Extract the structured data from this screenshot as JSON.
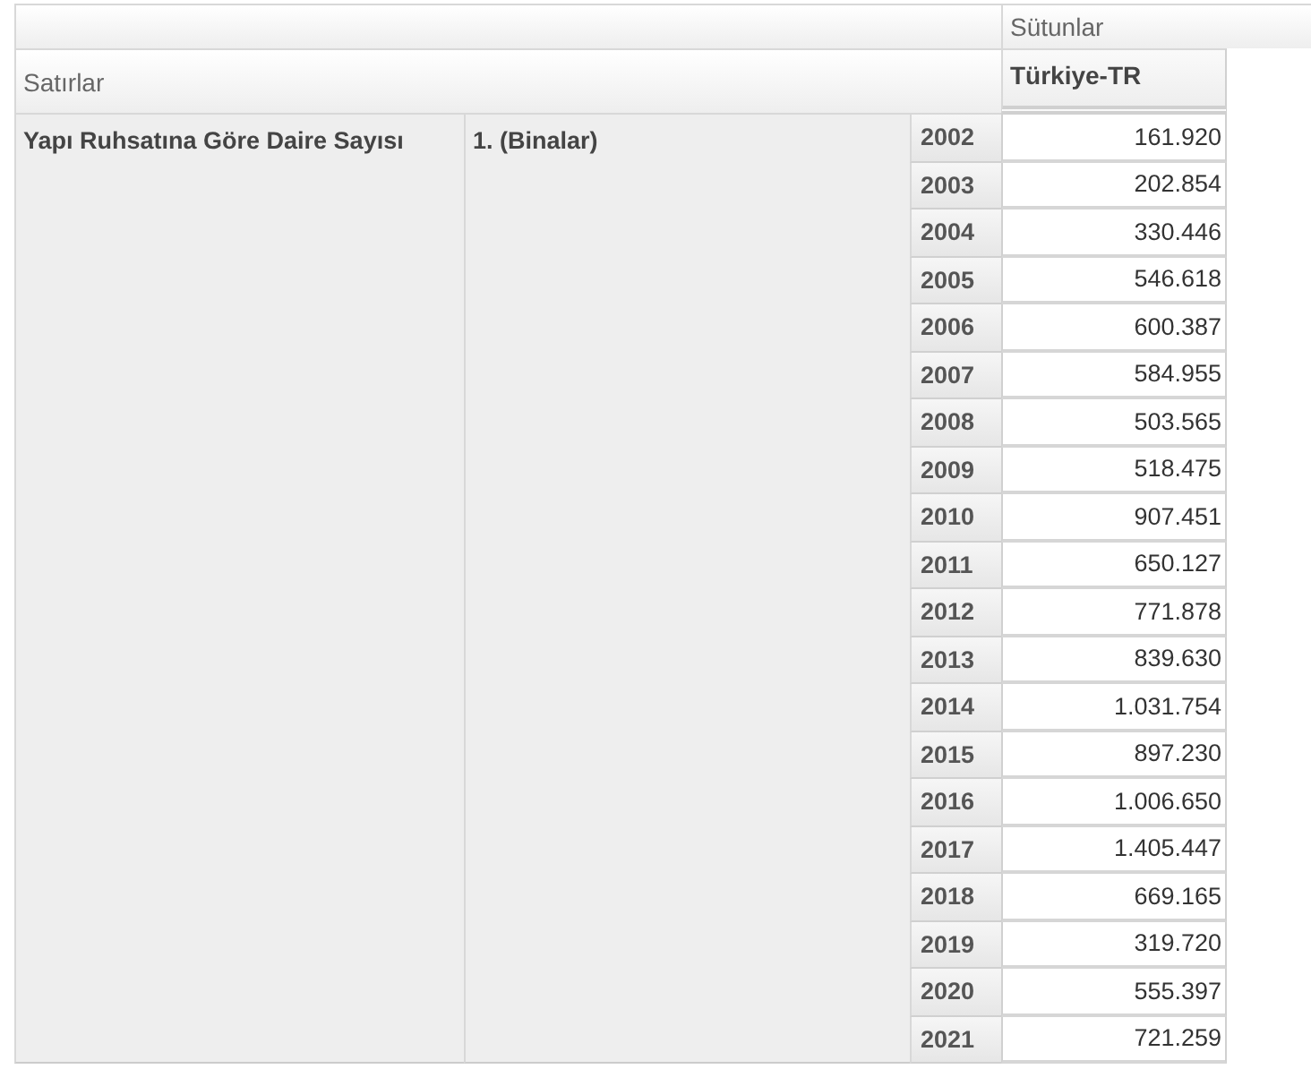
{
  "columns_header": "Sütunlar",
  "rows_header": "Satırlar",
  "column": "Türkiye-TR",
  "row_group": {
    "label": "Yapı Ruhsatına Göre Daire Sayısı",
    "sub_label": "1. (Binalar)"
  },
  "rows": [
    {
      "year": "2002",
      "value": "161.920"
    },
    {
      "year": "2003",
      "value": "202.854"
    },
    {
      "year": "2004",
      "value": "330.446"
    },
    {
      "year": "2005",
      "value": "546.618"
    },
    {
      "year": "2006",
      "value": "600.387"
    },
    {
      "year": "2007",
      "value": "584.955"
    },
    {
      "year": "2008",
      "value": "503.565"
    },
    {
      "year": "2009",
      "value": "518.475"
    },
    {
      "year": "2010",
      "value": "907.451"
    },
    {
      "year": "2011",
      "value": "650.127"
    },
    {
      "year": "2012",
      "value": "771.878"
    },
    {
      "year": "2013",
      "value": "839.630"
    },
    {
      "year": "2014",
      "value": "1.031.754"
    },
    {
      "year": "2015",
      "value": "897.230"
    },
    {
      "year": "2016",
      "value": "1.006.650"
    },
    {
      "year": "2017",
      "value": "1.405.447"
    },
    {
      "year": "2018",
      "value": "669.165"
    },
    {
      "year": "2019",
      "value": "319.720"
    },
    {
      "year": "2020",
      "value": "555.397"
    },
    {
      "year": "2021",
      "value": "721.259"
    }
  ]
}
